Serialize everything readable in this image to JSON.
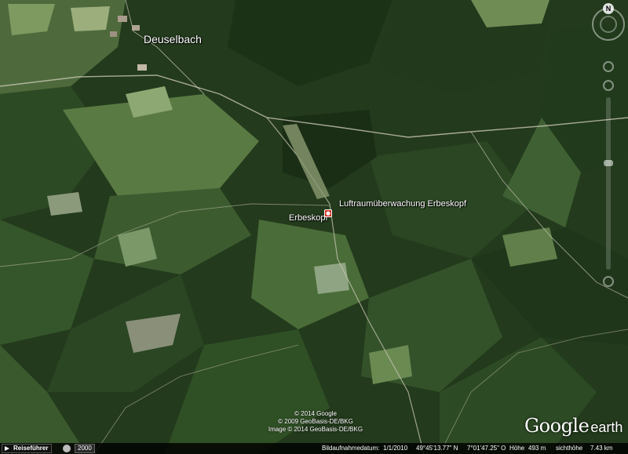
{
  "map": {
    "labels": {
      "town": "Deuselbach",
      "peak": "Erbeskopf",
      "poi": "Luftraumüberwachung Erbeskopf"
    }
  },
  "nav": {
    "north": "N"
  },
  "copyright": {
    "lines": [
      "© 2014 Google",
      "© 2009 GeoBasis-DE/BKG",
      "Image © 2014 GeoBasis-DE/BKG"
    ]
  },
  "brand": {
    "google": "Google",
    "earth": "earth"
  },
  "status_bar": {
    "tour_label": "Reiseführer",
    "history_year": "2000",
    "imagery_date_label": "Bildaufnahmedatum:",
    "imagery_date": "1/1/2010",
    "latitude": "49°45'13.77\" N",
    "longitude": "7°01'47.25\" O",
    "elevation_label": "Höhe",
    "elevation": "493 m",
    "eye_alt_label": "sichthöhe",
    "eye_alt": "7.43 km"
  },
  "colors": {
    "forest_dark": "#1e3418",
    "forest_mid": "#2f4f25",
    "meadow": "#5f7c45",
    "marker": "#d42a1c"
  }
}
